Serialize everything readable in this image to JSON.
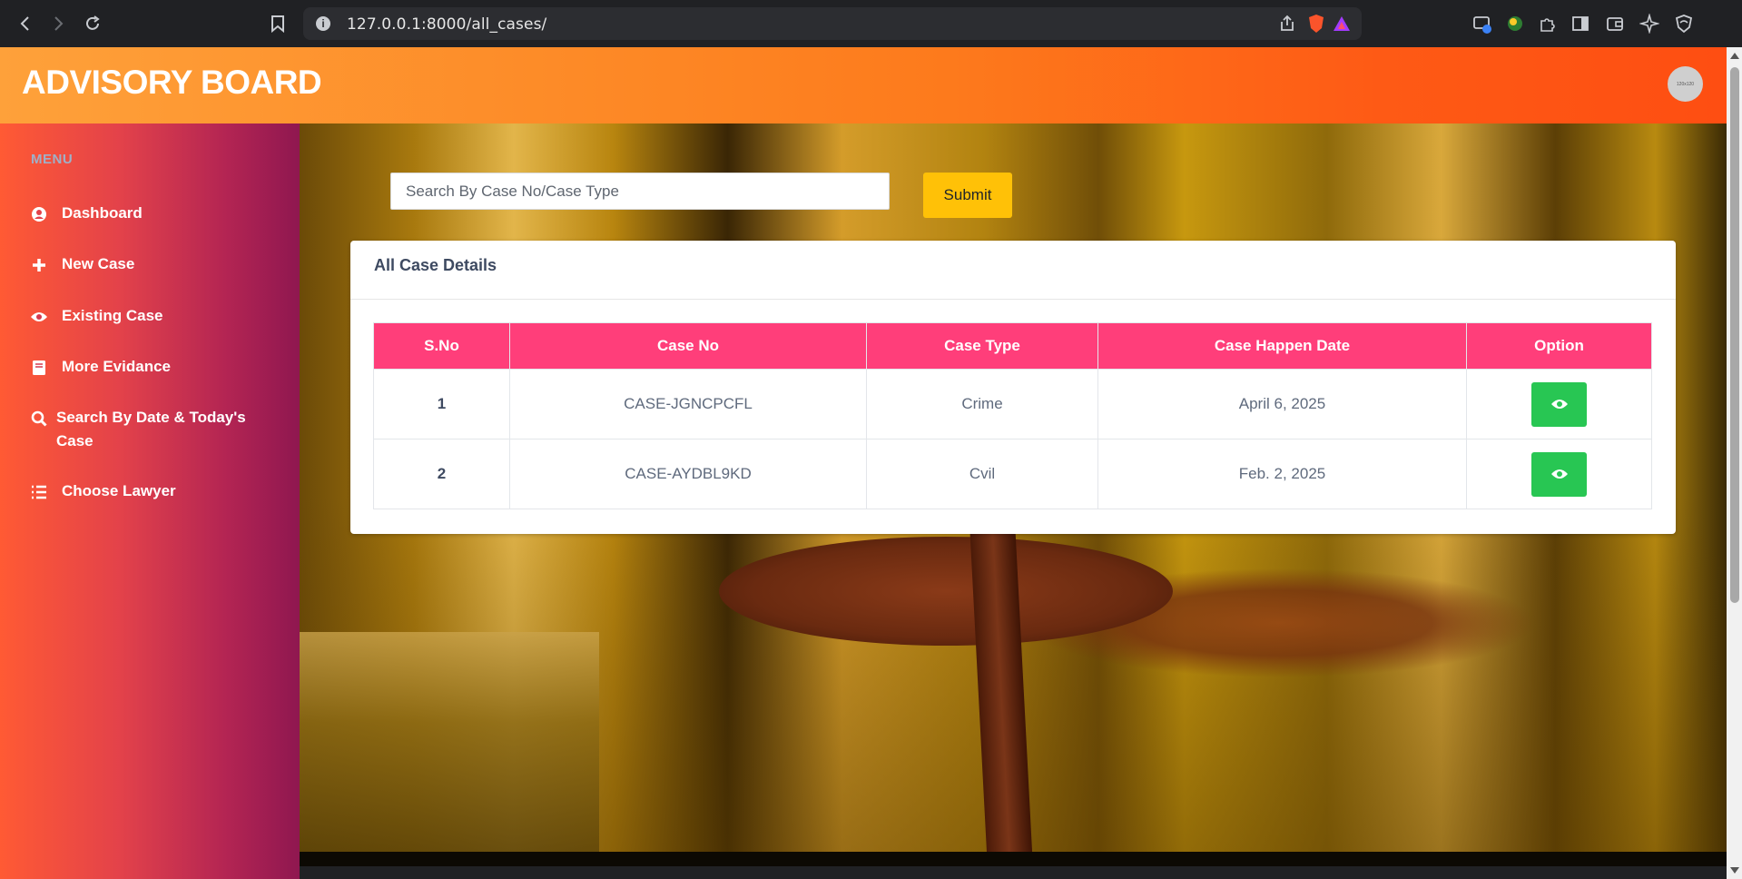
{
  "browser": {
    "url": "127.0.0.1:8000/all_cases/"
  },
  "header": {
    "brand": "ADVISORY BOARD",
    "avatar_text": "120x120"
  },
  "sidebar": {
    "menu_title": "MENU",
    "items": [
      {
        "label": "Dashboard",
        "icon": "user-circle-icon"
      },
      {
        "label": "New Case",
        "icon": "plus-icon"
      },
      {
        "label": "Existing Case",
        "icon": "eye-icon"
      },
      {
        "label": "More Evidance",
        "icon": "book-icon"
      },
      {
        "label": "Search By Date & Today's Case",
        "icon": "search-icon"
      },
      {
        "label": "Choose Lawyer",
        "icon": "list-icon"
      }
    ]
  },
  "search": {
    "placeholder": "Search By Case No/Case Type",
    "value": "",
    "submit_label": "Submit"
  },
  "card": {
    "title": "All Case Details"
  },
  "table": {
    "headers": [
      "S.No",
      "Case No",
      "Case Type",
      "Case Happen Date",
      "Option"
    ],
    "rows": [
      {
        "sno": "1",
        "case_no": "CASE-JGNCPCFL",
        "case_type": "Crime",
        "date": "April 6, 2025"
      },
      {
        "sno": "2",
        "case_no": "CASE-AYDBL9KD",
        "case_type": "Cvil",
        "date": "Feb. 2, 2025"
      }
    ]
  },
  "colors": {
    "header_start": "#fea13a",
    "header_end": "#fe4e12",
    "table_header": "#ff3e7a",
    "view_button": "#28c653",
    "submit_button": "#ffc107"
  }
}
